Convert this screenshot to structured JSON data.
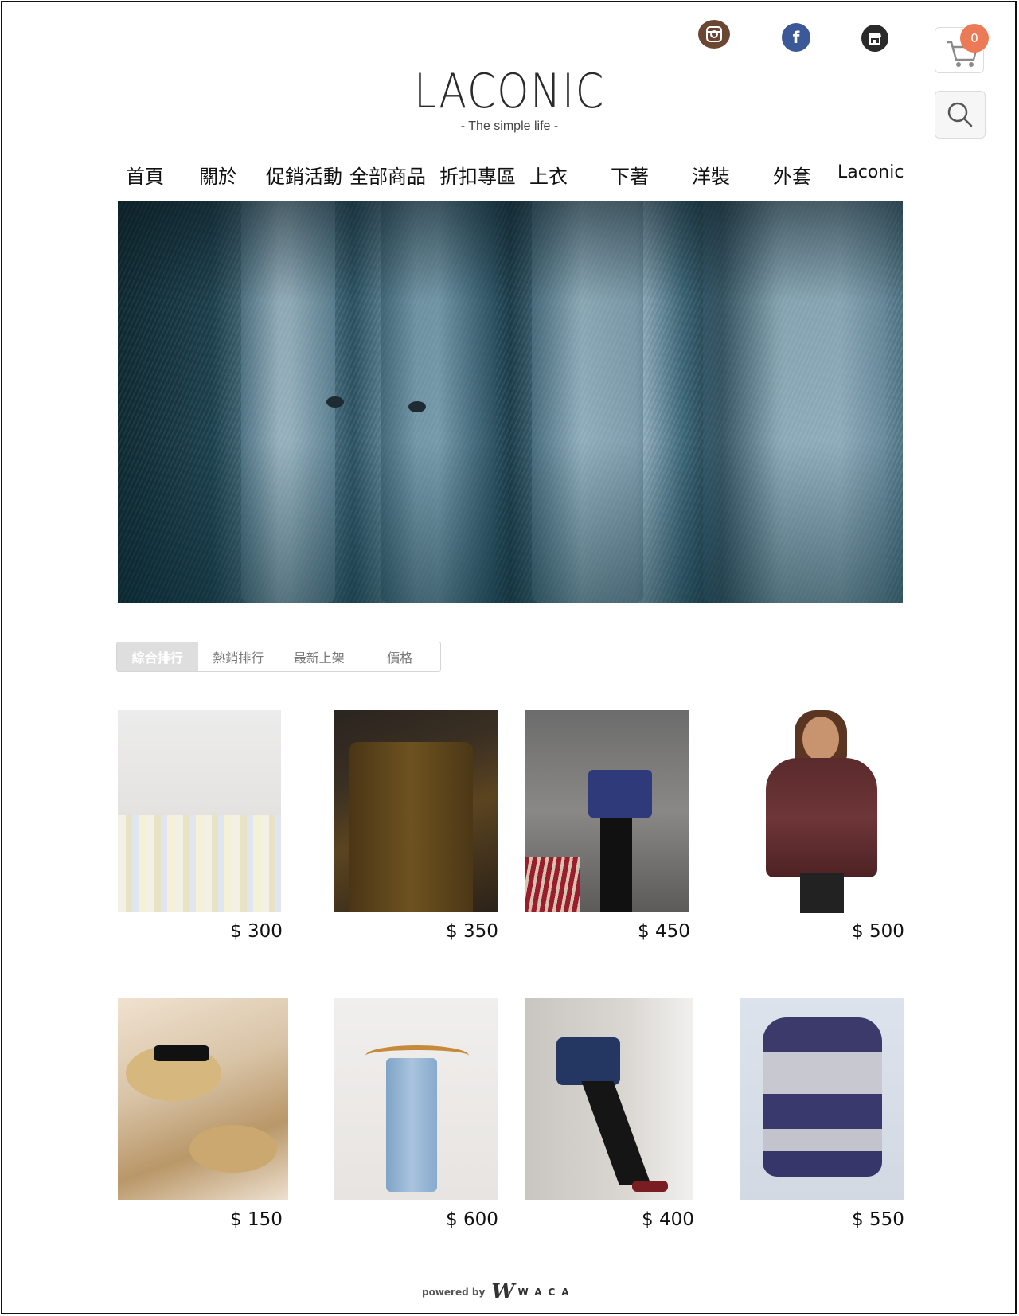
{
  "brand": {
    "logo_text": "LACONIC",
    "tagline": "- The simple life -"
  },
  "social": {
    "instagram": "instagram-icon",
    "facebook": "facebook-icon",
    "store": "store-icon",
    "facebook_glyph": "f"
  },
  "cart": {
    "count": "0"
  },
  "nav": {
    "items": [
      {
        "label": "首頁"
      },
      {
        "label": "關於"
      },
      {
        "label": "促銷活動"
      },
      {
        "label": "全部商品"
      },
      {
        "label": "折扣專區"
      },
      {
        "label": "上衣"
      },
      {
        "label": "下著"
      },
      {
        "label": "洋裝"
      },
      {
        "label": "外套"
      },
      {
        "label": "Laconic"
      }
    ]
  },
  "sort_tabs": {
    "active": 0,
    "items": [
      {
        "label": "綜合排行"
      },
      {
        "label": "熱銷排行"
      },
      {
        "label": "最新上架"
      },
      {
        "label": "價格"
      }
    ]
  },
  "products": [
    {
      "price": "$ 300"
    },
    {
      "price": "$ 350"
    },
    {
      "price": "$ 450"
    },
    {
      "price": "$ 500"
    },
    {
      "price": "$ 150"
    },
    {
      "price": "$ 600"
    },
    {
      "price": "$ 400"
    },
    {
      "price": "$ 550"
    }
  ],
  "footer": {
    "powered_by": "powered by",
    "mark": "W",
    "brand": "WACA"
  },
  "colors": {
    "cart_badge": "#ec7a56",
    "instagram": "#6b4633",
    "facebook": "#3b5998",
    "store": "#2a2a2a",
    "active_tab": "#dedede"
  }
}
